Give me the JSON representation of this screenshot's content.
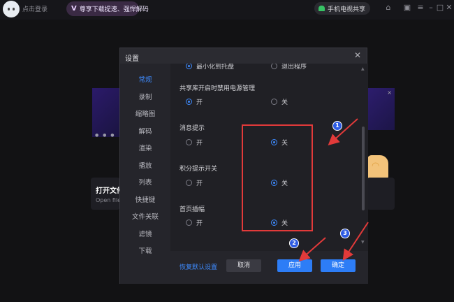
{
  "topbar": {
    "login_text": "点击登录",
    "vip_badge": "V",
    "vip_text": "尊享下载提速、强悍解码",
    "tv_label": "手机电视共享",
    "icons": [
      "shirt-icon",
      "gift-icon",
      "menu-icon",
      "minimize-icon",
      "maximize-icon",
      "close-icon"
    ]
  },
  "background": {
    "open_title": "打开文件",
    "open_sub": "Open file",
    "banner_dots": "● ● ●"
  },
  "dialog": {
    "title": "设置",
    "close": "✕",
    "nav": [
      "常规",
      "录制",
      "缩略图",
      "解码",
      "渲染",
      "播放",
      "列表",
      "快捷键",
      "文件关联",
      "滤镜",
      "下载"
    ],
    "active_nav": "常规",
    "top_options": {
      "left": "最小化到托盘",
      "right": "退出程序"
    },
    "sections": [
      {
        "title": "共享库开启时禁用电源管理",
        "on": "开",
        "off": "关",
        "selected": "on"
      },
      {
        "title": "消息提示",
        "on": "开",
        "off": "关",
        "selected": "off"
      },
      {
        "title": "积分提示开关",
        "on": "开",
        "off": "关",
        "selected": "off"
      },
      {
        "title": "首页插幅",
        "on": "开",
        "off": "关",
        "selected": "off"
      }
    ],
    "footer": {
      "restore": "恢复默认设置",
      "cancel": "取消",
      "apply": "应用",
      "ok": "确定"
    }
  },
  "annotations": {
    "badges": [
      "1",
      "2",
      "3"
    ],
    "color": "#e23a3a",
    "badge_color": "#2d5be3"
  },
  "colors": {
    "accent": "#2d7df6",
    "active_nav": "#3e8bff",
    "vip_pill": "#3a2a44",
    "android": "#37c264"
  }
}
